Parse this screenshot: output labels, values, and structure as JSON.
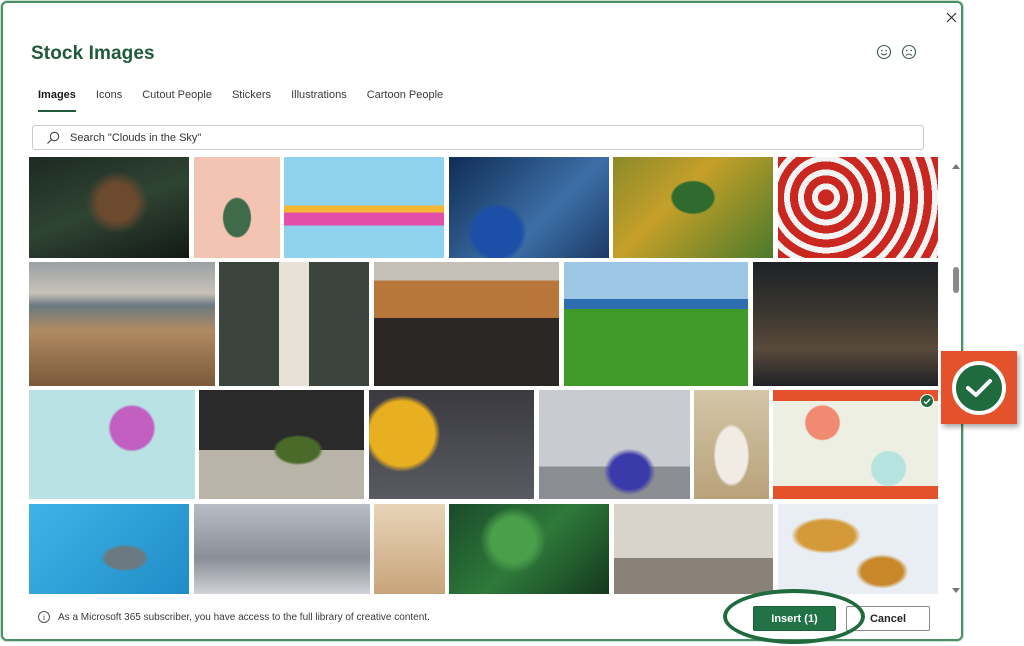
{
  "dialog": {
    "title": "Stock Images",
    "close_icon": "close-icon",
    "feedback": [
      {
        "icon": "smile-icon",
        "label": "Send a smile"
      },
      {
        "icon": "frown-icon",
        "label": "Send a frown"
      }
    ]
  },
  "tabs": [
    {
      "label": "Images",
      "active": true
    },
    {
      "label": "Icons",
      "active": false
    },
    {
      "label": "Cutout People",
      "active": false
    },
    {
      "label": "Stickers",
      "active": false
    },
    {
      "label": "Illustrations",
      "active": false
    },
    {
      "label": "Cartoon People",
      "active": false
    }
  ],
  "search": {
    "icon": "search-icon",
    "placeholder": "Search \"Clouds in the Sky\"",
    "value": ""
  },
  "images": [
    {
      "row": 1,
      "subject": "tiger in bamboo",
      "selected": false
    },
    {
      "row": 1,
      "subject": "cactus on pink background",
      "selected": false
    },
    {
      "row": 1,
      "subject": "sticky notes and pencil",
      "selected": false
    },
    {
      "row": 1,
      "subject": "IV drip with gloved hand",
      "selected": false
    },
    {
      "row": 1,
      "subject": "aerial soccer field in forest",
      "selected": false
    },
    {
      "row": 1,
      "subject": "red and white beach umbrellas",
      "selected": false
    },
    {
      "row": 2,
      "subject": "coastal dunes at dusk",
      "selected": false
    },
    {
      "row": 2,
      "subject": "woman with red handbag",
      "selected": false
    },
    {
      "row": 2,
      "subject": "people at cafe table with laptop",
      "selected": false
    },
    {
      "row": 2,
      "subject": "golf ball on tee",
      "selected": false
    },
    {
      "row": 2,
      "subject": "bakery shelves with bread",
      "selected": false
    },
    {
      "row": 3,
      "subject": "pink ball on ramp",
      "selected": false
    },
    {
      "row": 3,
      "subject": "pickle jar and garlic",
      "selected": false
    },
    {
      "row": 3,
      "subject": "squash and pumpkins on wood",
      "selected": false
    },
    {
      "row": 3,
      "subject": "florist cutting flowers",
      "selected": false
    },
    {
      "row": 3,
      "subject": "veterinarian holding cat",
      "selected": false
    },
    {
      "row": 3,
      "subject": "percent sign with pie charts",
      "selected": true
    },
    {
      "row": 4,
      "subject": "stethoscope in scrubs pocket",
      "selected": false
    },
    {
      "row": 4,
      "subject": "balancing spheres",
      "selected": false
    },
    {
      "row": 4,
      "subject": "hands typing on laptop",
      "selected": false
    },
    {
      "row": 4,
      "subject": "green leaves",
      "selected": false
    },
    {
      "row": 4,
      "subject": "woman working in studio",
      "selected": false
    },
    {
      "row": 4,
      "subject": "travel photo prints",
      "selected": false
    }
  ],
  "scrollbar": {
    "position_fraction": 0.25
  },
  "footer": {
    "info_icon": "info-icon",
    "info_text": "As a Microsoft 365 subscriber, you have access to the full library of creative content.",
    "insert_label": "Insert (1)",
    "cancel_label": "Cancel"
  },
  "annotation": {
    "callout_icon": "checkmark-circle-icon",
    "highlight": "ellipse around Insert button"
  },
  "colors": {
    "accent": "#217346",
    "title": "#1f5b38",
    "callout_bg": "#e4522c"
  }
}
